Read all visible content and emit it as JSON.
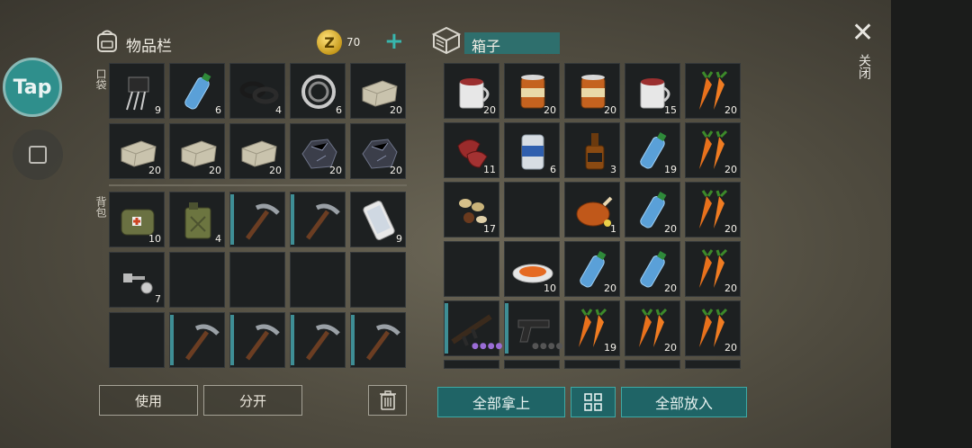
{
  "overlay": {
    "tap_label": "Tap"
  },
  "inventory": {
    "title": "物品栏",
    "coins": "70",
    "plus_label": "+",
    "pocket_label": "口袋",
    "backpack_label": "背包",
    "pocket_slots": [
      {
        "item": "circuit-component",
        "count": "9"
      },
      {
        "item": "water-bottle",
        "count": "6"
      },
      {
        "item": "rubber-rings",
        "count": "4"
      },
      {
        "item": "bearing",
        "count": "6"
      },
      {
        "item": "stone-block",
        "count": "20"
      },
      {
        "item": "stone-block",
        "count": "20"
      },
      {
        "item": "stone-block",
        "count": "20"
      },
      {
        "item": "stone-block",
        "count": "20"
      },
      {
        "item": "iron-ore",
        "count": "20"
      },
      {
        "item": "iron-ore",
        "count": "20"
      }
    ],
    "backpack_slots": [
      {
        "item": "first-aid-bag",
        "count": "10"
      },
      {
        "item": "jerrycan",
        "count": "4"
      },
      {
        "item": "pickaxe",
        "count": ""
      },
      {
        "item": "pickaxe",
        "count": ""
      },
      {
        "item": "smartphone",
        "count": "9"
      },
      {
        "item": "nuts-bolts",
        "count": "7"
      },
      {
        "item": "empty",
        "count": ""
      },
      {
        "item": "empty",
        "count": ""
      },
      {
        "item": "empty",
        "count": ""
      },
      {
        "item": "empty",
        "count": ""
      },
      {
        "item": "empty",
        "count": ""
      },
      {
        "item": "pickaxe",
        "count": ""
      },
      {
        "item": "pickaxe",
        "count": ""
      },
      {
        "item": "pickaxe",
        "count": ""
      },
      {
        "item": "pickaxe",
        "count": ""
      }
    ],
    "use_label": "使用",
    "split_label": "分开"
  },
  "container": {
    "title": "箱子",
    "close_label": "关闭",
    "take_all_label": "全部拿上",
    "put_all_label": "全部放入",
    "slots": [
      {
        "item": "mug-of-tea",
        "count": "20"
      },
      {
        "item": "canned-food",
        "count": "20"
      },
      {
        "item": "canned-food",
        "count": "20"
      },
      {
        "item": "mug-of-tea",
        "count": "15"
      },
      {
        "item": "carrots",
        "count": "20"
      },
      {
        "item": "raw-meat",
        "count": "11"
      },
      {
        "item": "beer-can",
        "count": "6"
      },
      {
        "item": "whiskey-bottle",
        "count": "3"
      },
      {
        "item": "water-bottle",
        "count": "19"
      },
      {
        "item": "carrots",
        "count": "20"
      },
      {
        "item": "seeds",
        "count": "17"
      },
      {
        "item": "empty",
        "count": ""
      },
      {
        "item": "roast-chicken",
        "count": "1"
      },
      {
        "item": "water-bottle",
        "count": "20"
      },
      {
        "item": "carrots",
        "count": "20"
      },
      {
        "item": "empty",
        "count": ""
      },
      {
        "item": "carrot-stew",
        "count": "10"
      },
      {
        "item": "water-bottle",
        "count": "20"
      },
      {
        "item": "water-bottle",
        "count": "20"
      },
      {
        "item": "carrots",
        "count": "20"
      },
      {
        "item": "assault-rifle",
        "count": ""
      },
      {
        "item": "pistol",
        "count": ""
      },
      {
        "item": "carrots",
        "count": "19"
      },
      {
        "item": "carrots",
        "count": "20"
      },
      {
        "item": "carrots",
        "count": "20"
      }
    ]
  },
  "colors": {
    "accent": "#2f8f8c",
    "slot_bg": "#1d2021",
    "rarity_purple": "#9a6cd6"
  }
}
